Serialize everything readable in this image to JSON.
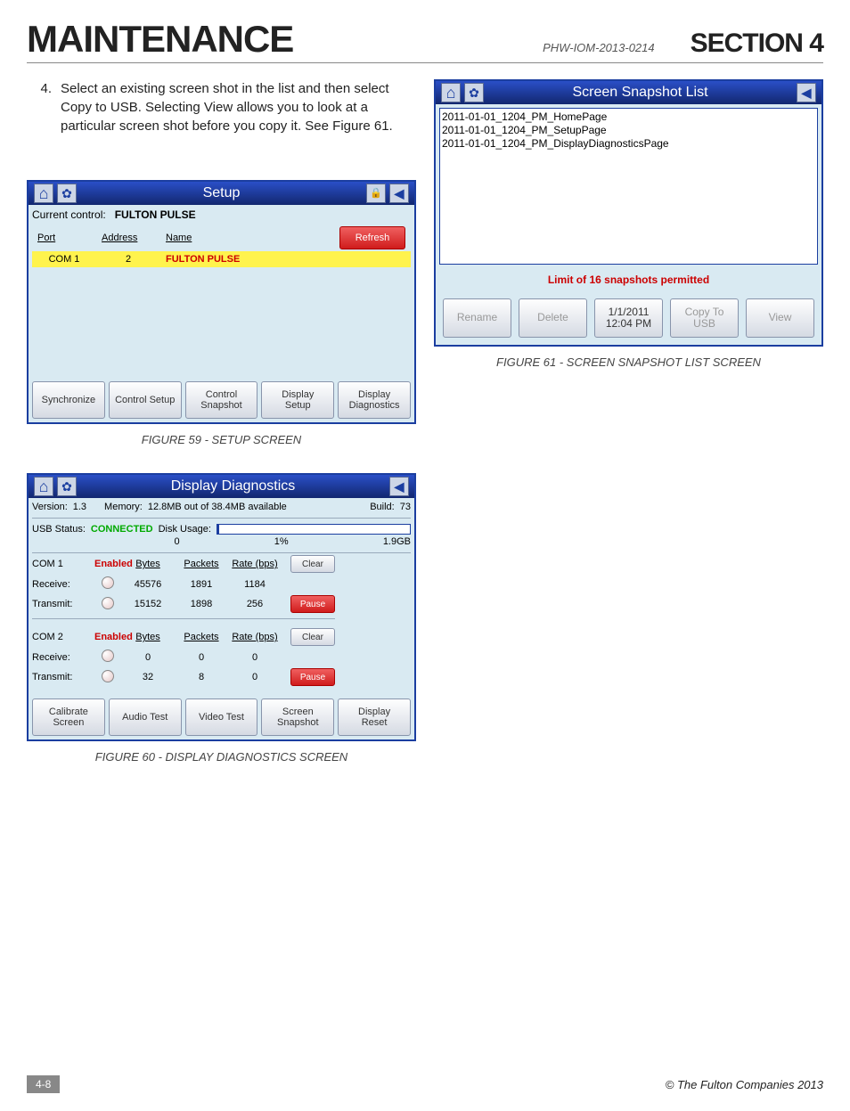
{
  "header": {
    "title": "MAINTENANCE",
    "doc_id": "PHW-IOM-2013-0214",
    "section": "SECTION 4"
  },
  "step": {
    "number": "4.",
    "text": "Select an existing screen shot in the list and then select Copy to USB.  Selecting View allows you to look at a particular screen shot before you copy it. See Figure 61."
  },
  "figure59": {
    "caption": "FIGURE 59 - SETUP SCREEN",
    "title": "Setup",
    "current_control_label": "Current control:",
    "current_control": "FULTON PULSE",
    "columns": {
      "port": "Port",
      "address": "Address",
      "name": "Name"
    },
    "row": {
      "port": "COM 1",
      "address": "2",
      "name": "FULTON PULSE"
    },
    "buttons": {
      "refresh": "Refresh",
      "sync": "Synchronize",
      "ctrl_setup": "Control Setup",
      "ctrl_snap": "Control Snapshot",
      "disp_setup": "Display Setup",
      "disp_diag": "Display Diagnostics"
    }
  },
  "figure60": {
    "caption": "FIGURE 60 - DISPLAY DIAGNOSTICS SCREEN",
    "title": "Display Diagnostics",
    "version_label": "Version:",
    "version": "1.3",
    "memory_label": "Memory:",
    "memory": "12.8MB out of 38.4MB available",
    "build_label": "Build:",
    "build": "73",
    "usb_label": "USB Status:",
    "usb_status": "CONNECTED",
    "disk_label": "Disk Usage:",
    "disk_zero": "0",
    "disk_pct": "1%",
    "disk_total": "1.9GB",
    "headers": {
      "bytes": "Bytes",
      "packets": "Packets",
      "rate": "Rate (bps)"
    },
    "com1": {
      "label": "COM 1",
      "enabled": "Enabled",
      "receive_label": "Receive:",
      "transmit_label": "Transmit:",
      "rx_bytes": "45576",
      "rx_packets": "1891",
      "rx_rate": "1184",
      "tx_bytes": "15152",
      "tx_packets": "1898",
      "tx_rate": "256"
    },
    "com2": {
      "label": "COM 2",
      "enabled": "Enabled",
      "receive_label": "Receive:",
      "transmit_label": "Transmit:",
      "rx_bytes": "0",
      "rx_packets": "0",
      "rx_rate": "0",
      "tx_bytes": "32",
      "tx_packets": "8",
      "tx_rate": "0"
    },
    "buttons": {
      "clear": "Clear",
      "pause": "Pause",
      "calibrate": "Calibrate Screen",
      "audio": "Audio Test",
      "video": "Video Test",
      "snapshot": "Screen Snapshot",
      "reset": "Display Reset"
    }
  },
  "figure61": {
    "caption": "FIGURE 61 - SCREEN SNAPSHOT LIST SCREEN",
    "title": "Screen Snapshot List",
    "items": [
      "2011-01-01_1204_PM_HomePage",
      "2011-01-01_1204_PM_SetupPage",
      "2011-01-01_1204_PM_DisplayDiagnosticsPage"
    ],
    "limit": "Limit of 16 snapshots permitted",
    "datetime": "1/1/2011\n12:04 PM",
    "buttons": {
      "rename": "Rename",
      "delete": "Delete",
      "copy": "Copy To USB",
      "view": "View"
    }
  },
  "footer": {
    "page": "4-8",
    "copyright": "© The Fulton Companies 2013"
  }
}
